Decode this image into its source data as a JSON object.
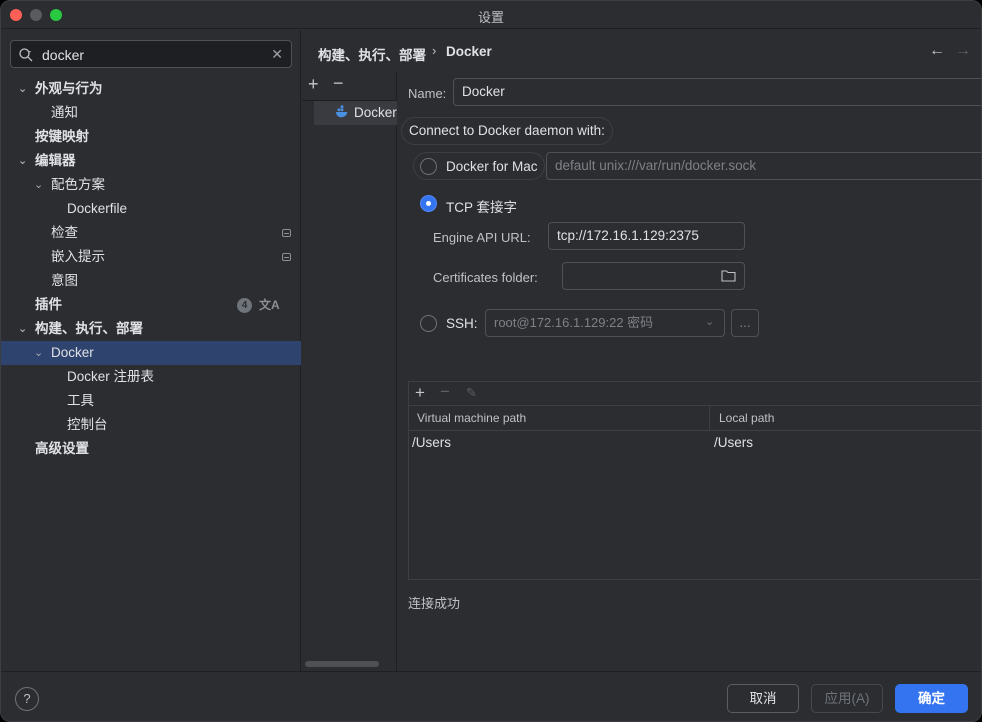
{
  "window": {
    "title": "设置"
  },
  "search": {
    "value": "docker"
  },
  "tree": [
    {
      "label": "外观与行为",
      "level": 0,
      "expanded": true,
      "bold": true
    },
    {
      "label": "通知",
      "level": 1
    },
    {
      "label": "按键映射",
      "level": 0,
      "bold": true
    },
    {
      "label": "编辑器",
      "level": 0,
      "expanded": true,
      "bold": true
    },
    {
      "label": "配色方案",
      "level": 1,
      "expanded": true
    },
    {
      "label": "Dockerfile",
      "level": 2
    },
    {
      "label": "检查",
      "level": 1
    },
    {
      "label": "嵌入提示",
      "level": 1
    },
    {
      "label": "意图",
      "level": 1
    },
    {
      "label": "插件",
      "level": 0,
      "bold": true,
      "badge": "4",
      "translate_glyph": "文A"
    },
    {
      "label": "构建、执行、部署",
      "level": 0,
      "expanded": true,
      "bold": true
    },
    {
      "label": "Docker",
      "level": 1,
      "expanded": true,
      "selected": true
    },
    {
      "label": "Docker 注册表",
      "level": 2
    },
    {
      "label": "工具",
      "level": 2
    },
    {
      "label": "控制台",
      "level": 2
    },
    {
      "label": "高级设置",
      "level": 0,
      "bold": true
    }
  ],
  "breadcrumb": {
    "parent": "构建、执行、部署",
    "current": "Docker"
  },
  "sublist": {
    "item": "Docker"
  },
  "form": {
    "name_label": "Name:",
    "name_value": "Docker",
    "connect_title": "Connect to Docker daemon with:",
    "docker_mac_label": "Docker for Mac",
    "docker_mac_value": "default  unix:///var/run/docker.sock",
    "tcp_label": "TCP 套接字",
    "engine_label": "Engine API URL:",
    "engine_value": "tcp://172.16.1.129:2375",
    "certs_label": "Certificates folder:",
    "certs_value": "",
    "ssh_label": "SSH:",
    "ssh_value": "root@172.16.1.129:22 密码",
    "ssh_more": "...",
    "selected_connection": "tcp"
  },
  "mappings": {
    "columns": [
      "Virtual machine path",
      "Local path"
    ],
    "rows": [
      [
        "/Users",
        "/Users"
      ]
    ]
  },
  "status": {
    "text": "连接成功"
  },
  "footer": {
    "help": "?",
    "cancel": "取消",
    "apply": "应用(A)",
    "ok": "确定"
  },
  "colors": {
    "accent": "#3574f0",
    "selection": "#2e436e",
    "background": "#2b2d30"
  }
}
